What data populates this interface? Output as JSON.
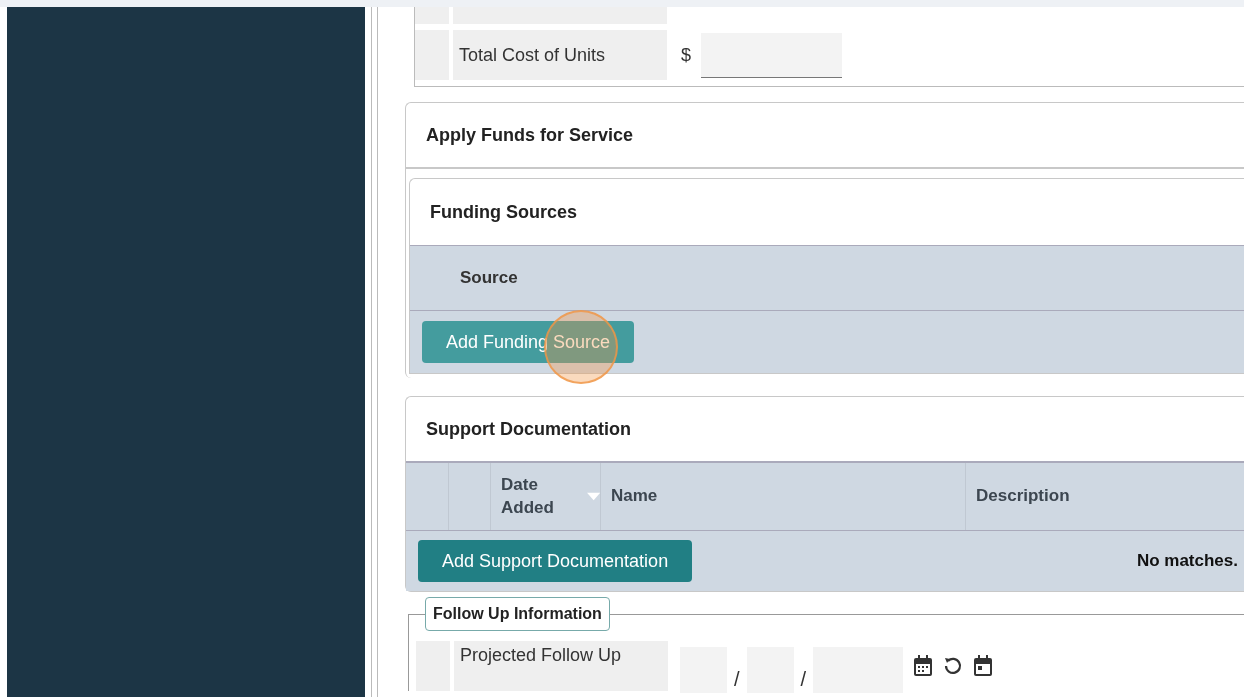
{
  "cost_rows": [
    {
      "label": "",
      "kind": "cut"
    },
    {
      "label": "Total Cost of Units",
      "kind": "currency",
      "prefix": "$"
    }
  ],
  "apply_funds": {
    "title": "Apply Funds for Service"
  },
  "funding_sources": {
    "title": "Funding Sources",
    "columns": [
      "Source"
    ],
    "button": "Add Funding Source"
  },
  "support_documentation": {
    "title": "Support Documentation",
    "columns": [
      {
        "label": "Date Added",
        "sorted": true
      },
      {
        "label": "Name",
        "sorted": false
      },
      {
        "label": "Description",
        "sorted": false
      }
    ],
    "button": "Add Support Documentation",
    "empty_text": "No matches."
  },
  "follow_up": {
    "legend": "Follow Up Information",
    "fields": [
      {
        "label": "Projected Follow Up",
        "separators": [
          "/",
          "/"
        ]
      }
    ]
  }
}
